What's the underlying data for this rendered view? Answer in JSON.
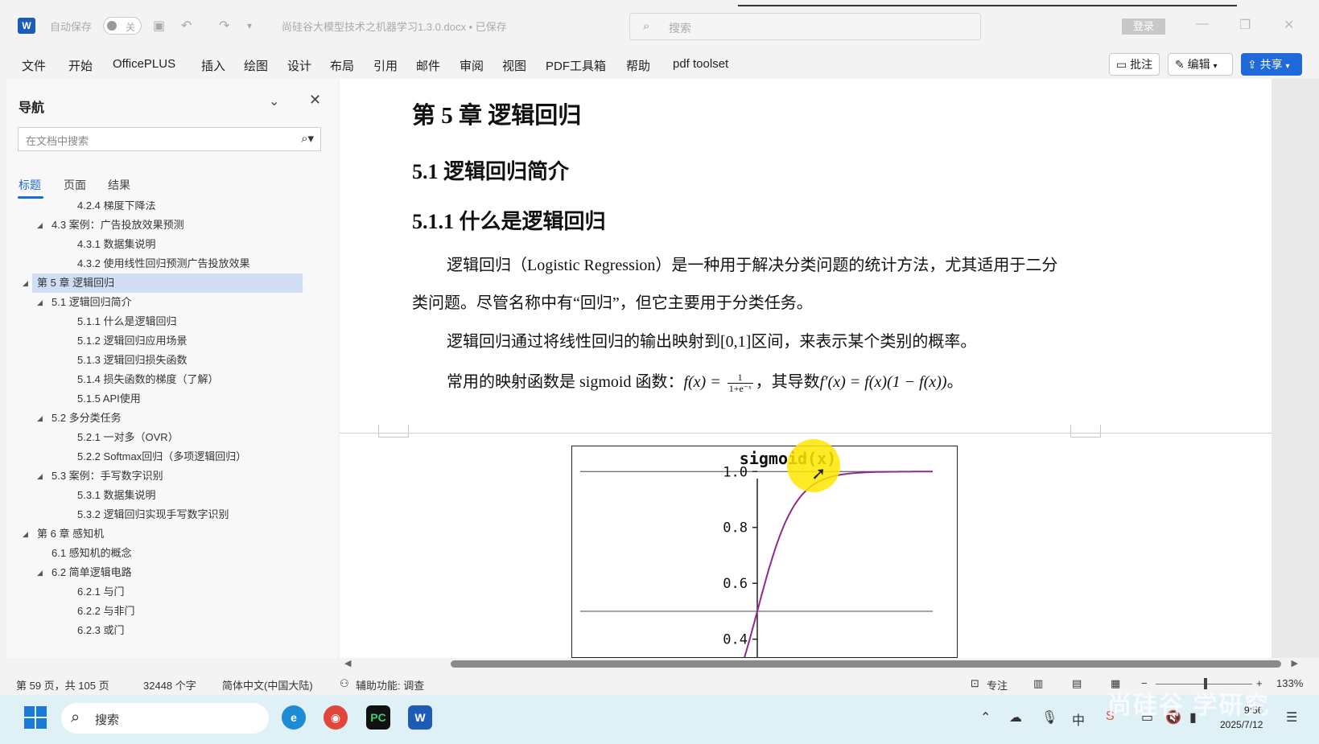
{
  "titlebar": {
    "logo": "W",
    "autosave_label": "自动保存",
    "autosave_state": "关",
    "doc_title": "尚硅谷大模型技术之机器学习1.3.0.docx • 已保存",
    "search_placeholder": "搜索",
    "login_label": "登录"
  },
  "menu": {
    "items": [
      "文件",
      "开始",
      "OfficePLUS",
      "插入",
      "绘图",
      "设计",
      "布局",
      "引用",
      "邮件",
      "审阅",
      "视图",
      "PDF工具箱",
      "帮助",
      "pdf toolset"
    ],
    "comment_label": "批注",
    "edit_label": "编辑",
    "share_label": "共享",
    "accent": "#1f6ad8"
  },
  "nav": {
    "title": "导航",
    "search_placeholder": "在文档中搜索",
    "tabs": [
      "标题",
      "页面",
      "结果"
    ],
    "active_tab": 0,
    "items": [
      {
        "text": "4.2.4 梯度下降法",
        "level": 3,
        "expandable": false
      },
      {
        "text": "4.3 案例：广告投放效果预测",
        "level": 2,
        "expandable": true
      },
      {
        "text": "4.3.1 数据集说明",
        "level": 3,
        "expandable": false
      },
      {
        "text": "4.3.2 使用线性回归预测广告投放效果",
        "level": 3,
        "expandable": false
      },
      {
        "text": "第 5 章 逻辑回归",
        "level": 1,
        "expandable": true,
        "selected": true
      },
      {
        "text": "5.1 逻辑回归简介",
        "level": 2,
        "expandable": true
      },
      {
        "text": "5.1.1 什么是逻辑回归",
        "level": 3,
        "expandable": false
      },
      {
        "text": "5.1.2 逻辑回归应用场景",
        "level": 3,
        "expandable": false
      },
      {
        "text": "5.1.3 逻辑回归损失函数",
        "level": 3,
        "expandable": false
      },
      {
        "text": "5.1.4 损失函数的梯度（了解）",
        "level": 3,
        "expandable": false
      },
      {
        "text": "5.1.5 API使用",
        "level": 3,
        "expandable": false
      },
      {
        "text": "5.2 多分类任务",
        "level": 2,
        "expandable": true
      },
      {
        "text": "5.2.1 一对多（OVR）",
        "level": 3,
        "expandable": false
      },
      {
        "text": "5.2.2 Softmax回归（多项逻辑回归）",
        "level": 3,
        "expandable": false
      },
      {
        "text": "5.3 案例：手写数字识别",
        "level": 2,
        "expandable": true
      },
      {
        "text": "5.3.1 数据集说明",
        "level": 3,
        "expandable": false
      },
      {
        "text": "5.3.2 逻辑回归实现手写数字识别",
        "level": 3,
        "expandable": false
      },
      {
        "text": "第 6 章 感知机",
        "level": 1,
        "expandable": true
      },
      {
        "text": "6.1 感知机的概念",
        "level": 2,
        "expandable": false
      },
      {
        "text": "6.2 简单逻辑电路",
        "level": 2,
        "expandable": true
      },
      {
        "text": "6.2.1 与门",
        "level": 3,
        "expandable": false
      },
      {
        "text": "6.2.2 与非门",
        "level": 3,
        "expandable": false
      },
      {
        "text": "6.2.3 或门",
        "level": 3,
        "expandable": false
      }
    ]
  },
  "doc": {
    "chapter": "第 5 章  逻辑回归",
    "section": "5.1  逻辑回归简介",
    "subsection": "5.1.1  什么是逻辑回归",
    "para1_line1": "逻辑回归（Logistic Regression）是一种用于解决分类问题的统计方法，尤其适用于二分",
    "para1_line2": "类问题。尽管名称中有“回归”，但它主要用于分类任务。",
    "para2": "逻辑回归通过将线性回归的输出映射到[0,1]区间，来表示某个类别的概率。",
    "para3_prefix": "常用的映射函数是 sigmoid 函数：",
    "formula_lhs": "f(x) = ",
    "formula_num": "1",
    "formula_den": "1+e⁻ˣ",
    "para3_mid": "，其导数",
    "formula_deriv": "f′(x) = f(x)(1 − f(x))",
    "para3_end": "。"
  },
  "chart_data": {
    "type": "line",
    "title": "sigmoid(x)",
    "xlabel": "",
    "ylabel": "",
    "yticks": [
      "1.0",
      "0.8",
      "0.6",
      "0.4"
    ],
    "ylim_visible": [
      0.33,
      1.09
    ],
    "xlim": [
      -10,
      10
    ],
    "series": [
      {
        "function": "1/(1+exp(-x))",
        "color": "#8e2b8e"
      }
    ],
    "gridlines_y": [
      1.0,
      0.5
    ]
  },
  "status": {
    "page": "第 59 页，共 105 页",
    "words": "32448 个字",
    "language": "简体中文(中国大陆)",
    "accessibility": "辅助功能: 调查",
    "focus": "专注",
    "zoom": "133%"
  },
  "taskbar": {
    "search_placeholder": "搜索",
    "time": "9:56",
    "date": "2025/7/12",
    "watermark": "尚硅谷 学研究"
  }
}
